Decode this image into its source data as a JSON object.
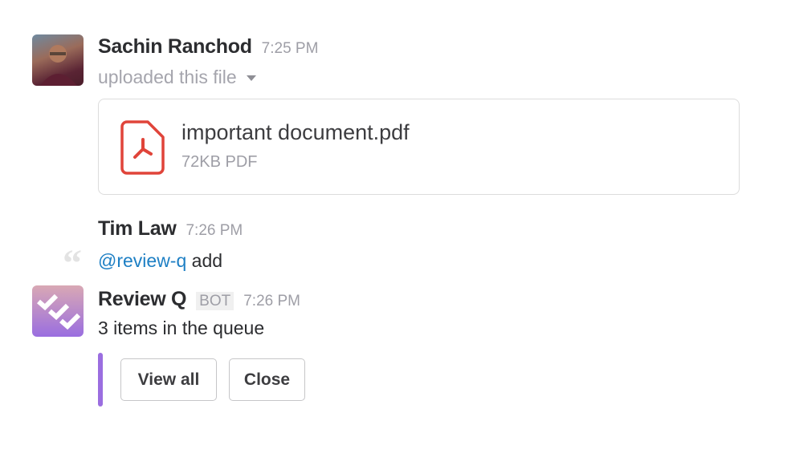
{
  "messages": [
    {
      "author": "Sachin Ranchod",
      "time": "7:25 PM",
      "subtitle": "uploaded this file",
      "file": {
        "name": "important document.pdf",
        "meta": "72KB PDF",
        "icon": "pdf-icon"
      }
    },
    {
      "author": "Tim Law",
      "time": "7:26 PM",
      "mention": "@review-q",
      "text": " add"
    },
    {
      "author": "Review Q",
      "badge": "BOT",
      "time": "7:26 PM",
      "text": "3 items in the queue",
      "buttons": [
        "View all",
        "Close"
      ]
    }
  ],
  "colors": {
    "accent_bar": "#9b6ee0",
    "mention": "#1d7fc4",
    "pdf": "#e0443a"
  }
}
